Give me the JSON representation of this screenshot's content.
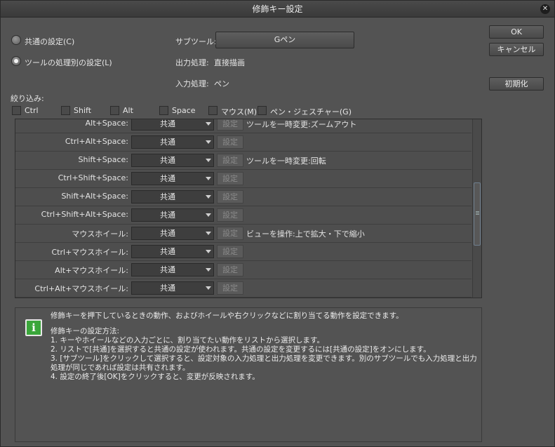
{
  "window": {
    "title": "修飾キー設定",
    "close_icon": "close-icon"
  },
  "mode": {
    "common_label": "共通の設定(C)",
    "per_tool_label": "ツールの処理別の設定(L)",
    "selected": "per_tool"
  },
  "subtool": {
    "label": "サブツール:",
    "value": "Gペン"
  },
  "output": {
    "label": "出力処理:",
    "value": "直接描画"
  },
  "input": {
    "label": "入力処理:",
    "value": "ペン"
  },
  "buttons": {
    "ok": "OK",
    "cancel": "キャンセル",
    "reset": "初期化"
  },
  "filter": {
    "label": "絞り込み:",
    "items": [
      "Ctrl",
      "Shift",
      "Alt",
      "Space",
      "マウス(M)",
      "ペン・ジェスチャー(G)"
    ]
  },
  "grid": {
    "set_label": "設定",
    "rows": [
      {
        "key": "Alt+Space:",
        "mode": "共通",
        "action": "ツールを一時変更:ズームアウト"
      },
      {
        "key": "Ctrl+Alt+Space:",
        "mode": "共通",
        "action": ""
      },
      {
        "key": "Shift+Space:",
        "mode": "共通",
        "action": "ツールを一時変更:回転"
      },
      {
        "key": "Ctrl+Shift+Space:",
        "mode": "共通",
        "action": ""
      },
      {
        "key": "Shift+Alt+Space:",
        "mode": "共通",
        "action": ""
      },
      {
        "key": "Ctrl+Shift+Alt+Space:",
        "mode": "共通",
        "action": ""
      },
      {
        "key": "マウスホイール:",
        "mode": "共通",
        "action": "ビューを操作:上で拡大・下で縮小"
      },
      {
        "key": "Ctrl+マウスホイール:",
        "mode": "共通",
        "action": ""
      },
      {
        "key": "Alt+マウスホイール:",
        "mode": "共通",
        "action": ""
      },
      {
        "key": "Ctrl+Alt+マウスホイール:",
        "mode": "共通",
        "action": ""
      }
    ]
  },
  "info": {
    "icon": "info-icon",
    "lines": [
      "修飾キーを押下しているときの動作、およびホイールや右クリックなどに割り当てる動作を設定できます。",
      "",
      "修飾キーの設定方法:",
      "1. キーやホイールなどの入力ごとに、割り当てたい動作をリストから選択します。",
      "2. リストで[共通]を選択すると共通の設定が使われます。共通の設定を変更するには[共通の設定]をオンにします。",
      "3. [サブツール]をクリックして選択すると、設定対象の入力処理と出力処理を変更できます。別のサブツールでも入力処理と出力",
      "処理が同じであれば設定は共有されます。",
      "4. 設定の終了後[OK]をクリックすると、変更が反映されます。"
    ]
  }
}
